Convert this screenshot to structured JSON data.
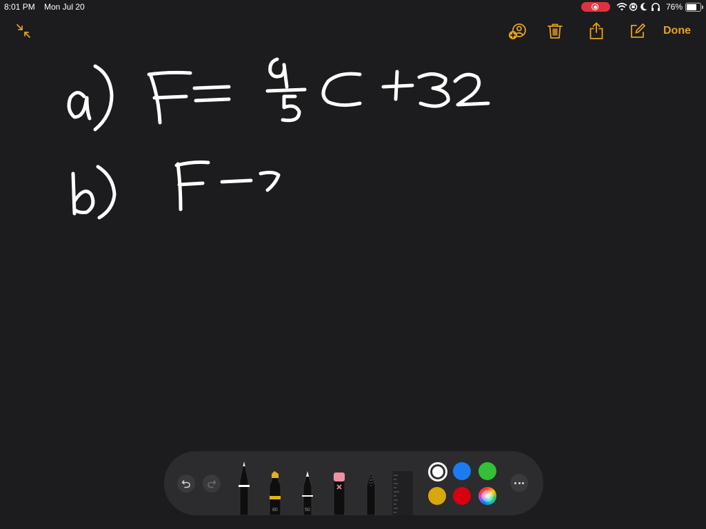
{
  "status_bar": {
    "time": "8:01 PM",
    "date": "Mon Jul 20",
    "battery": "76%",
    "battery_level": 0.76
  },
  "toolbar": {
    "done_label": "Done",
    "accent_color": "#e8a21d",
    "icons": [
      "collapse-icon",
      "add-person-icon",
      "trash-icon",
      "share-icon",
      "compose-icon"
    ]
  },
  "note": {
    "ink_color": "#ffffff",
    "lines": [
      {
        "label": "a)",
        "expression": "F = 9/5 C + 32"
      },
      {
        "label": "b)",
        "expression": "F →"
      }
    ]
  },
  "palette": {
    "tools": [
      {
        "name": "pen",
        "label": ""
      },
      {
        "name": "marker",
        "label": "80"
      },
      {
        "name": "pencil",
        "label": "50"
      },
      {
        "name": "eraser",
        "label": ""
      },
      {
        "name": "lasso",
        "label": ""
      },
      {
        "name": "ruler",
        "label": ""
      }
    ],
    "colors": [
      {
        "name": "white",
        "hex": "#ffffff",
        "selected": true
      },
      {
        "name": "blue",
        "hex": "#1a7cf0",
        "selected": false
      },
      {
        "name": "green",
        "hex": "#34c038",
        "selected": false
      },
      {
        "name": "yellow",
        "hex": "#d6a80c",
        "selected": false
      },
      {
        "name": "red",
        "hex": "#d8000f",
        "selected": false
      },
      {
        "name": "multicolor",
        "hex": "",
        "selected": false
      }
    ]
  }
}
